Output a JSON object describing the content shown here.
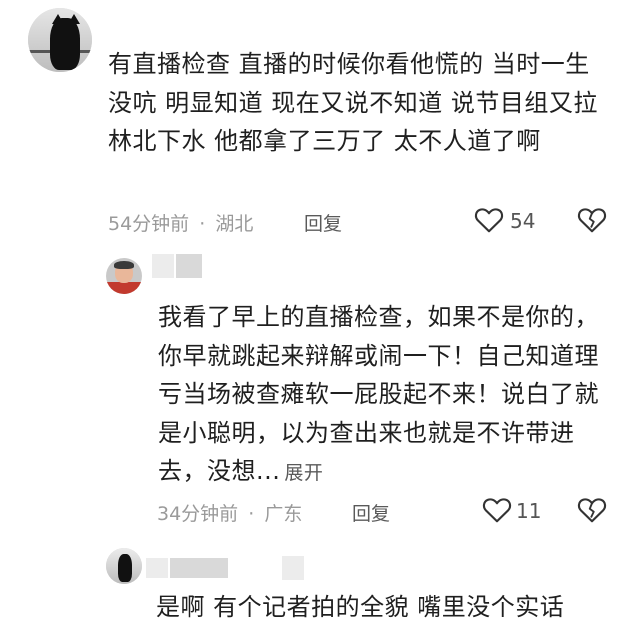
{
  "main_comment": {
    "text": "有直播检查 直播的时候你看他慌的 当时一生没吭 明显知道 现在又说不知道 说节目组又拉林北下水 他都拿了三万了 太不人道了啊",
    "time": "54分钟前",
    "location": "湖北",
    "reply_label": "回复",
    "like_count": "54"
  },
  "reply_1": {
    "text": "我看了早上的直播检查，如果不是你的，你早就跳起来辩解或闹一下！自己知道理亏当场被查瘫软一屁股起不来！说白了就是小聪明，以为查出来也就是不许带进去，没想...",
    "expand_label": "展开",
    "time": "34分钟前",
    "location": "广东",
    "reply_label": "回复",
    "like_count": "11"
  },
  "reply_2": {
    "text": "是啊 有个记者拍的全貌 嘴里没个实话"
  },
  "meta_separator": "·",
  "icons": [
    "heart-icon",
    "broken-heart-icon"
  ]
}
